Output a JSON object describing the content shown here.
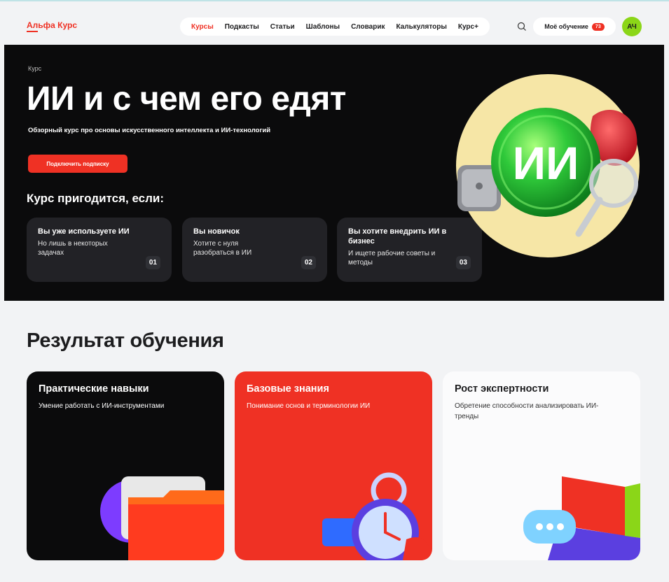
{
  "header": {
    "logo": "Альфа Курс",
    "nav": [
      "Курсы",
      "Подкасты",
      "Статьи",
      "Шаблоны",
      "Словарик",
      "Калькуляторы",
      "Курс+"
    ],
    "active_nav": "Курсы",
    "my_learning": "Моё обучение",
    "my_learning_count": "73",
    "avatar_initials": "АЧ"
  },
  "hero": {
    "kicker": "Курс",
    "title": "ИИ и с чем его едят",
    "subtitle": "Обзорный курс про основы искусственного интеллекта и ИИ-технологий",
    "cta": "Подключить подписку",
    "art_text": "ИИ",
    "useful_title": "Курс пригодится, если:",
    "cards": [
      {
        "title": "Вы уже используете ИИ",
        "text": "Но лишь в некоторых задачах",
        "num": "01"
      },
      {
        "title": "Вы новичок",
        "text": "Хотите с нуля разобраться в ИИ",
        "num": "02"
      },
      {
        "title": "Вы хотите внедрить ИИ в бизнес",
        "text": "И ищете рабочие советы и методы",
        "num": "03"
      }
    ]
  },
  "results": {
    "title": "Результат обучения",
    "cards": [
      {
        "title": "Практические навыки",
        "text": "Умение работать с ИИ-инструментами"
      },
      {
        "title": "Базовые знания",
        "text": "Понимание основ и терминологии ИИ"
      },
      {
        "title": "Рост экспертности",
        "text": "Обретение способности анализировать ИИ-тренды"
      }
    ]
  },
  "colors": {
    "accent": "#ef3124",
    "dark": "#0b0b0c",
    "green": "#8bd618"
  }
}
